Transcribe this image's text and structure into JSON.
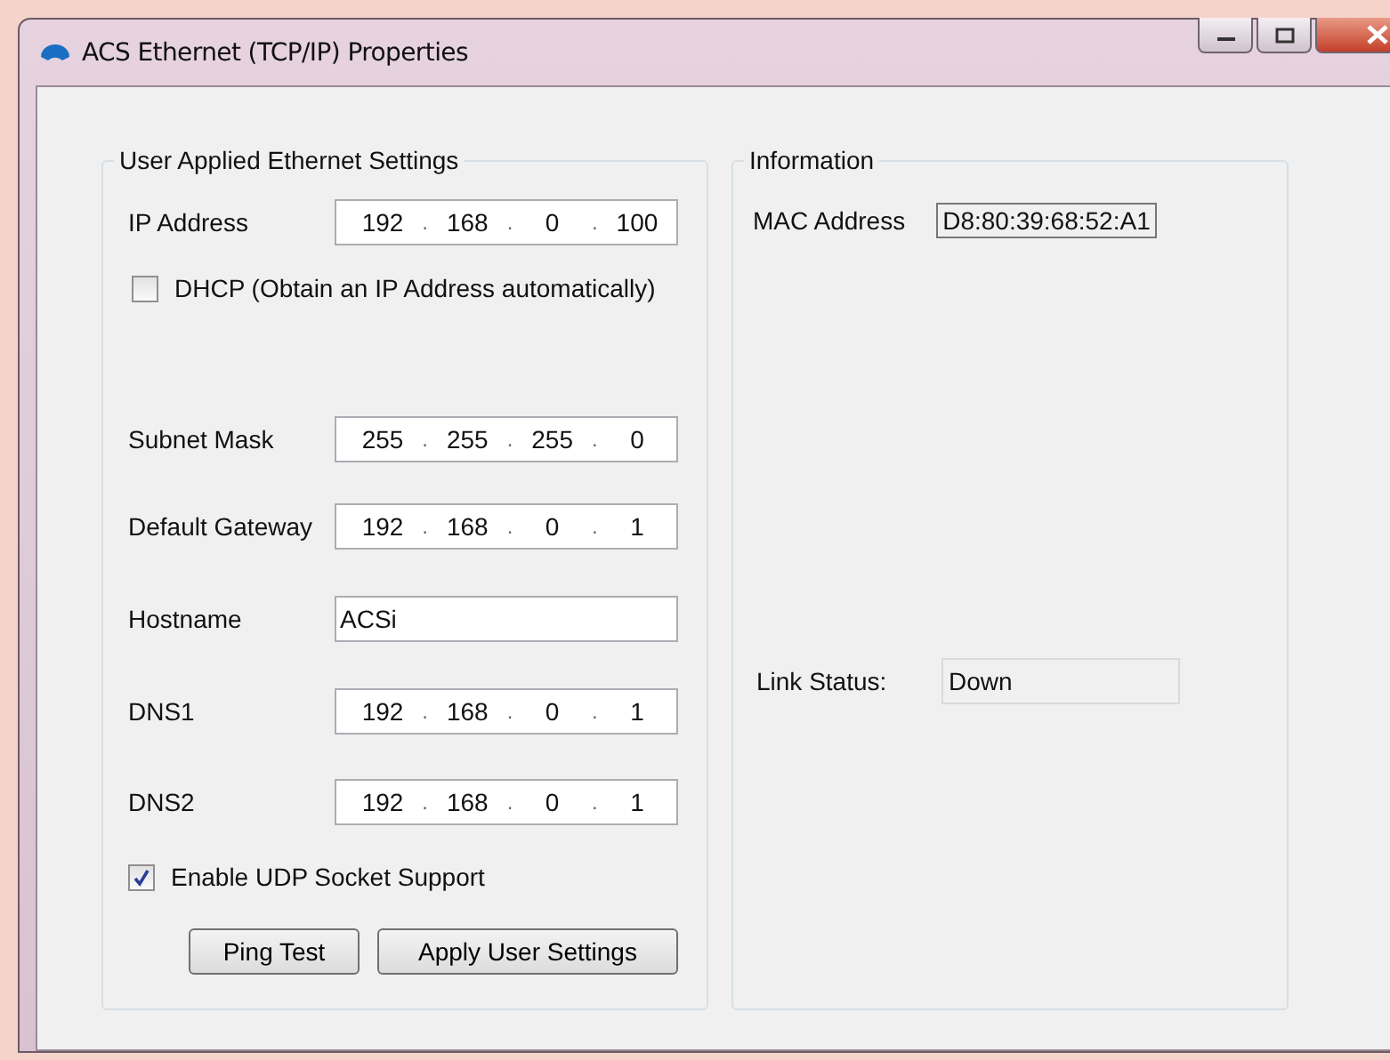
{
  "window": {
    "title": "ACS Ethernet (TCP/IP) Properties"
  },
  "settings": {
    "title": "User Applied Ethernet Settings",
    "fields": [
      {
        "kind": "ip",
        "label": "IP Address",
        "separator": ".",
        "octets": [
          "192",
          "168",
          "0",
          "100"
        ]
      },
      {
        "kind": "checkbox",
        "label": "DHCP (Obtain an IP Address automatically)",
        "checked": false
      },
      {
        "kind": "ip",
        "label": "Subnet Mask",
        "separator": ".",
        "octets": [
          "255",
          "255",
          "255",
          "0"
        ]
      },
      {
        "kind": "ip",
        "label": "Default Gateway",
        "separator": ".",
        "octets": [
          "192",
          "168",
          "0",
          "1"
        ]
      },
      {
        "kind": "text",
        "label": "Hostname",
        "value": "ACSi"
      },
      {
        "kind": "ip",
        "label": "DNS1",
        "separator": ".",
        "octets": [
          "192",
          "168",
          "0",
          "1"
        ]
      },
      {
        "kind": "ip",
        "label": "DNS2",
        "separator": ".",
        "octets": [
          "192",
          "168",
          "0",
          "1"
        ]
      },
      {
        "kind": "checkbox",
        "label": "Enable UDP Socket Support",
        "checked": true
      }
    ],
    "buttons": [
      "Ping Test",
      "Apply User Settings"
    ]
  },
  "information": {
    "title": "Information",
    "mac": {
      "label": "MAC Address",
      "value": "D8:80:39:68:52:A1"
    },
    "link_status": {
      "label": "Link Status:",
      "value": "Down"
    }
  }
}
